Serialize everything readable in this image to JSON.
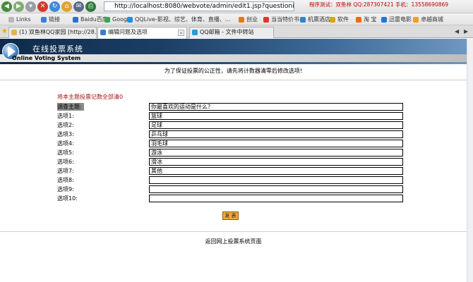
{
  "browser": {
    "url": "http://localhost:8080/webvote/admin/edit1.jsp?questionid=11",
    "status_text": "程序测试：双鱼林 QQ:287307421 手机：13558690869",
    "links": [
      {
        "label": "Links",
        "color": "#b8b8b8"
      },
      {
        "label": "链接",
        "color": "#3d7ed8"
      },
      {
        "label": "Baidu百度",
        "color": "#2c6fd0"
      },
      {
        "label": "Google",
        "color": "#3aa55a"
      },
      {
        "label": "QQLive-影视、综艺、体育、直播、...",
        "color": "#1f8fdc"
      },
      {
        "label": "创业",
        "color": "#e07a18"
      },
      {
        "label": "当当特价书",
        "color": "#d33b2c"
      },
      {
        "label": "机票酒店",
        "color": "#2b86c9"
      },
      {
        "label": "软件",
        "color": "#d9a520"
      },
      {
        "label": "淘 宝",
        "color": "#f06a0c"
      },
      {
        "label": "迅雷电影",
        "color": "#1e78d2"
      },
      {
        "label": "卓越商城",
        "color": "#f0a020"
      }
    ],
    "tabs": [
      {
        "label": "(1) 双鱼林QQ家园 [http://28...",
        "color": "#e8b24a",
        "active": false
      },
      {
        "label": "编辑问题及选项",
        "color": "#3a7bd5",
        "active": true
      },
      {
        "label": "QQ邮箱 - 文件中转站",
        "color": "#2d9ad8",
        "active": false
      }
    ]
  },
  "site": {
    "title_cn": "在线投票系统",
    "title_en": "Online Voting System"
  },
  "notice": "为了保证投票的公正性，请先将计数器清零后修改选项!",
  "count_text": "将本主题投票记数全部清0",
  "form": {
    "subject_label": "调查主题:",
    "subject_value": "你最喜欢的运动是什么？",
    "options": [
      {
        "label": "选项1:",
        "value": "篮球"
      },
      {
        "label": "选项2:",
        "value": "足球"
      },
      {
        "label": "选项3:",
        "value": "乒乓球"
      },
      {
        "label": "选项4:",
        "value": "羽毛球"
      },
      {
        "label": "选项5:",
        "value": "游泳"
      },
      {
        "label": "选项6:",
        "value": "滑冰"
      },
      {
        "label": "选项7:",
        "value": "其他"
      },
      {
        "label": "选项8:",
        "value": ""
      },
      {
        "label": "选项9:",
        "value": ""
      },
      {
        "label": "选项10:",
        "value": ""
      }
    ],
    "submit_label": "发 表"
  },
  "footer_link": "返回网上投票系统页面",
  "colors": {
    "header_dark": "#0f2a4a",
    "count_text": "#a31212",
    "submit_bg": "#f2a93b"
  }
}
